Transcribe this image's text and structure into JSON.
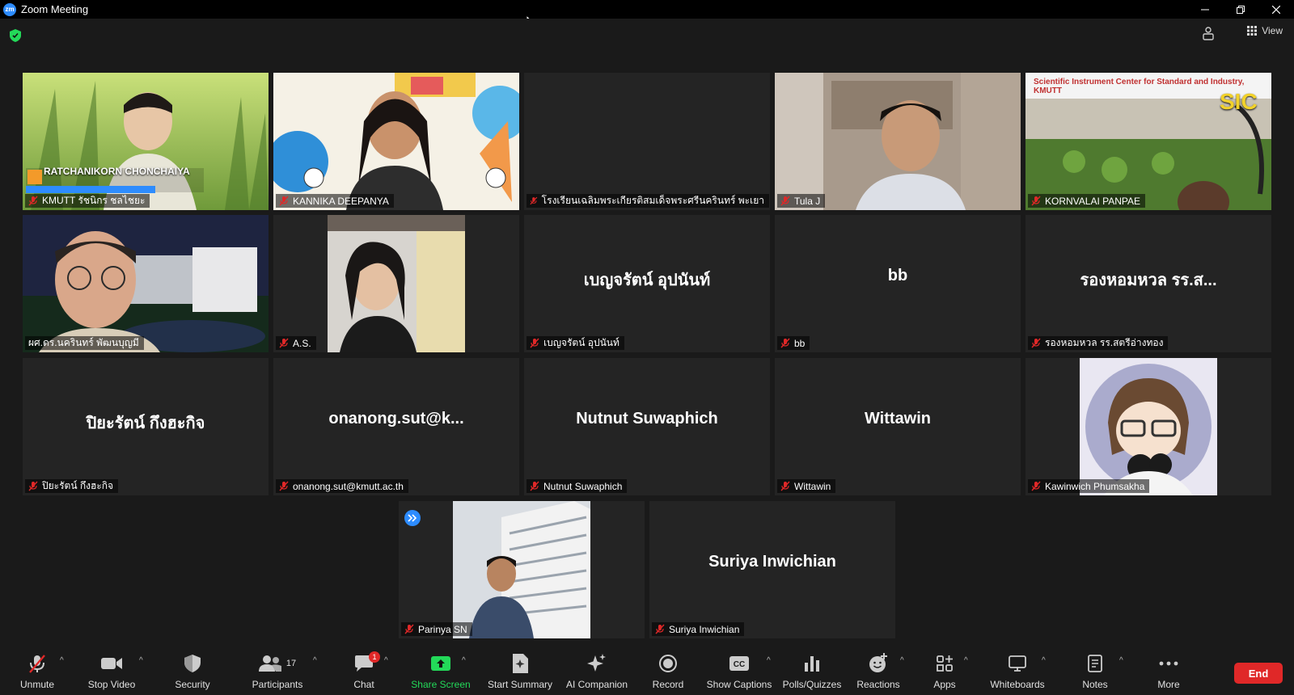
{
  "window": {
    "title": "Zoom Meeting",
    "app_logo_text": "zm"
  },
  "topbar": {
    "view_label": "View"
  },
  "tiles": [
    {
      "name": "KMUTT รัชนิกร ชลไชยะ",
      "overlay": "RATCHANIKORN CHONCHAIYA"
    },
    {
      "name": "KANNIKA DEEPANYA"
    },
    {
      "name": "โรงเรียนเฉลิมพระเกียรติสมเด็จพระศรีนครินทร์ พะเยา"
    },
    {
      "name": "Tula J"
    },
    {
      "name": "KORNVALAI PANPAE",
      "overlay": "Scientific Instrument Center for Standard and Industry, KMUTT",
      "logo": "SIC"
    },
    {
      "name": "ผศ.ดร.นครินทร์ พัฒนบุญมี"
    },
    {
      "name": "A.S."
    },
    {
      "name": "เบญจรัตน์ อุปนันท์",
      "display": "เบญจรัตน์ อุปนันท์"
    },
    {
      "name": "bb",
      "display": "bb"
    },
    {
      "name": "รองหอมหวล รร.สตรีอ่างทอง",
      "display": "รองหอมหวล รร.ส..."
    },
    {
      "name": "ปิยะรัตน์ กึงฮะกิจ",
      "display": "ปิยะรัตน์ กึงฮะกิจ"
    },
    {
      "name": "onanong.sut@kmutt.ac.th",
      "display": "onanong.sut@k..."
    },
    {
      "name": "Nutnut Suwaphich",
      "display": "Nutnut Suwaphich"
    },
    {
      "name": "Wittawin",
      "display": "Wittawin"
    },
    {
      "name": "Kawinwich Phumsakha"
    },
    {
      "name": "Parinya SN"
    },
    {
      "name": "Suriya Inwichian",
      "display": "Suriya Inwichian"
    }
  ],
  "toolbar": {
    "unmute": "Unmute",
    "stop_video": "Stop Video",
    "security": "Security",
    "participants": "Participants",
    "participant_count": "17",
    "chat": "Chat",
    "chat_badge": "1",
    "share_screen": "Share Screen",
    "start_summary": "Start Summary",
    "ai_companion": "AI Companion",
    "record": "Record",
    "show_captions": "Show Captions",
    "polls": "Polls/Quizzes",
    "reactions": "Reactions",
    "apps": "Apps",
    "whiteboards": "Whiteboards",
    "notes": "Notes",
    "more": "More",
    "end": "End"
  },
  "colors": {
    "active_speaker": "#d6f272",
    "share_green": "#23d959",
    "end_red": "#e02828",
    "zoom_blue": "#2d8cff"
  }
}
